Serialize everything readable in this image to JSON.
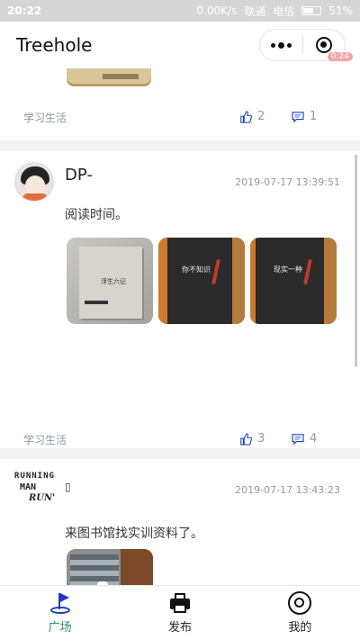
{
  "status_bar": {
    "time": "20:22",
    "speed": "0.00K/s",
    "carrier1": "联通",
    "carrier2": "电信",
    "battery": "51%"
  },
  "header": {
    "title": "Treehole",
    "timer_badge": "0:24"
  },
  "posts": [
    {
      "tag": "学习生活",
      "likes": "2",
      "comments": "1"
    },
    {
      "username": "DP-",
      "timestamp": "2019-07-17 13:39:51",
      "content": "阅读时间。",
      "tag": "学习生活",
      "likes": "3",
      "comments": "4",
      "images": [
        "book-cover-light",
        "book-cover-dark",
        "book-cover-dark"
      ]
    },
    {
      "username": "▯",
      "avatar_text": [
        "RUNNING",
        "MAN",
        "RUN'"
      ],
      "timestamp": "2019-07-17 13:43:23",
      "content": "来图书馆找实训资料了。",
      "images": [
        "library-photo"
      ]
    }
  ],
  "tabbar": {
    "items": [
      {
        "label": "广场",
        "icon": "flag-icon",
        "active": true
      },
      {
        "label": "发布",
        "icon": "printer-icon",
        "active": false
      },
      {
        "label": "我的",
        "icon": "profile-circle-icon",
        "active": false
      }
    ]
  },
  "colors": {
    "active_tab": "#2a8f5a",
    "meta_text": "#8a9aaa",
    "flag_blue": "#1a3cc2"
  }
}
